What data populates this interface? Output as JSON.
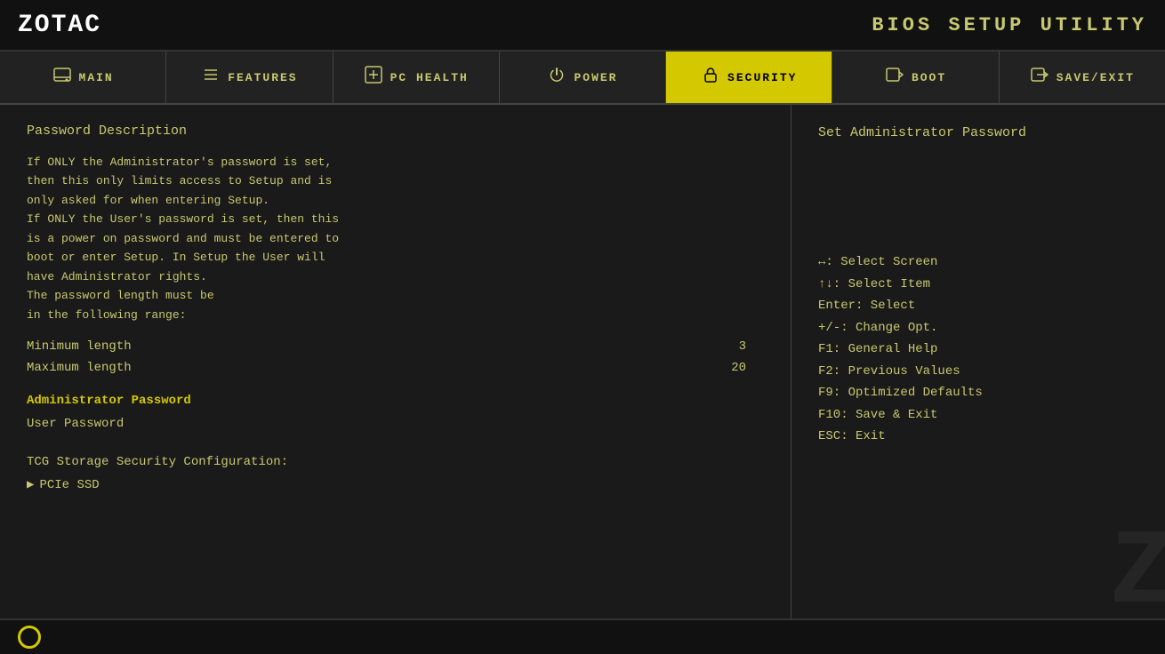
{
  "header": {
    "logo": "ZOTAC",
    "bios_title": "BIOS SETUP UTILITY"
  },
  "nav": {
    "tabs": [
      {
        "id": "main",
        "label": "MAIN",
        "icon": "drive"
      },
      {
        "id": "features",
        "label": "FEATURES",
        "icon": "list"
      },
      {
        "id": "pc_health",
        "label": "PC HEALTH",
        "icon": "plus-box"
      },
      {
        "id": "power",
        "label": "POWER",
        "icon": "power"
      },
      {
        "id": "security",
        "label": "SECURITY",
        "icon": "lock",
        "active": true
      },
      {
        "id": "boot",
        "label": "BOOT",
        "icon": "arrow-left-box"
      },
      {
        "id": "save_exit",
        "label": "SAVE/EXIT",
        "icon": "arrow-right-box"
      }
    ]
  },
  "left_panel": {
    "section_title": "Password Description",
    "description": "If ONLY the Administrator's password is set,\nthen this only limits access to Setup and is\nonly asked for when entering Setup.\nIf ONLY the User's password is set, then this\nis a power on password and must be entered to\nboot or enter Setup. In Setup the User will\nhave Administrator rights.\nThe password length must be\nin the following range:",
    "fields": [
      {
        "label": "Minimum length",
        "value": "3"
      },
      {
        "label": "Maximum length",
        "value": "20"
      }
    ],
    "active_item": "Administrator Password",
    "inactive_item": "User Password",
    "tcg_label": "TCG Storage Security Configuration:",
    "pcie_label": "PCIe SSD"
  },
  "right_panel": {
    "title": "Set Administrator Password",
    "help_items": [
      {
        "key": "↔:",
        "desc": "Select Screen"
      },
      {
        "key": "↑↓:",
        "desc": "Select Item"
      },
      {
        "key": "Enter:",
        "desc": "Select"
      },
      {
        "key": "+/-:",
        "desc": "Change Opt."
      },
      {
        "key": "F1:",
        "desc": "General Help"
      },
      {
        "key": "F2:",
        "desc": "Previous Values"
      },
      {
        "key": "F9:",
        "desc": "Optimized Defaults"
      },
      {
        "key": "F10:",
        "desc": "Save & Exit"
      },
      {
        "key": "ESC:",
        "desc": "Exit"
      }
    ]
  },
  "footer": {
    "circle_color": "#d4c800"
  },
  "colors": {
    "active_tab_bg": "#d4c800",
    "active_tab_text": "#000000",
    "active_item_text": "#d4c800",
    "body_bg": "#1a1a1a",
    "header_bg": "#111111",
    "text_color": "#c8c870"
  }
}
